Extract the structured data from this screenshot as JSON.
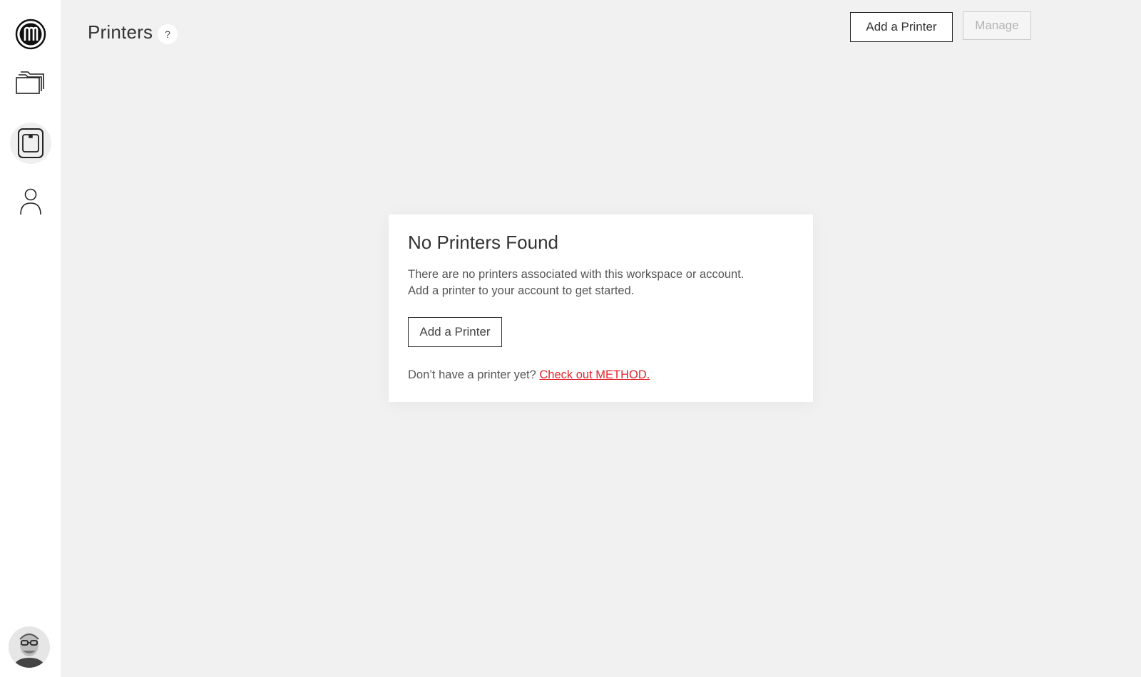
{
  "header": {
    "title": "Printers",
    "help_label": "?",
    "add_printer_label": "Add a Printer",
    "manage_label": "Manage"
  },
  "sidebar": {
    "items": [
      {
        "icon": "makerbot-logo-icon"
      },
      {
        "icon": "folders-icon"
      },
      {
        "icon": "printer-icon",
        "active": true
      },
      {
        "icon": "user-icon"
      }
    ],
    "avatar": "user-avatar"
  },
  "empty_state": {
    "title": "No Printers Found",
    "line1": "There are no printers associated with this workspace or account.",
    "line2": "Add a printer to your account to get started.",
    "button_label": "Add a Printer",
    "footer_text": "Don’t have a printer yet?",
    "footer_link": "Check out METHOD."
  },
  "colors": {
    "accent_link": "#e3242b",
    "background": "#f1f1f1",
    "sidebar": "#ffffff"
  }
}
